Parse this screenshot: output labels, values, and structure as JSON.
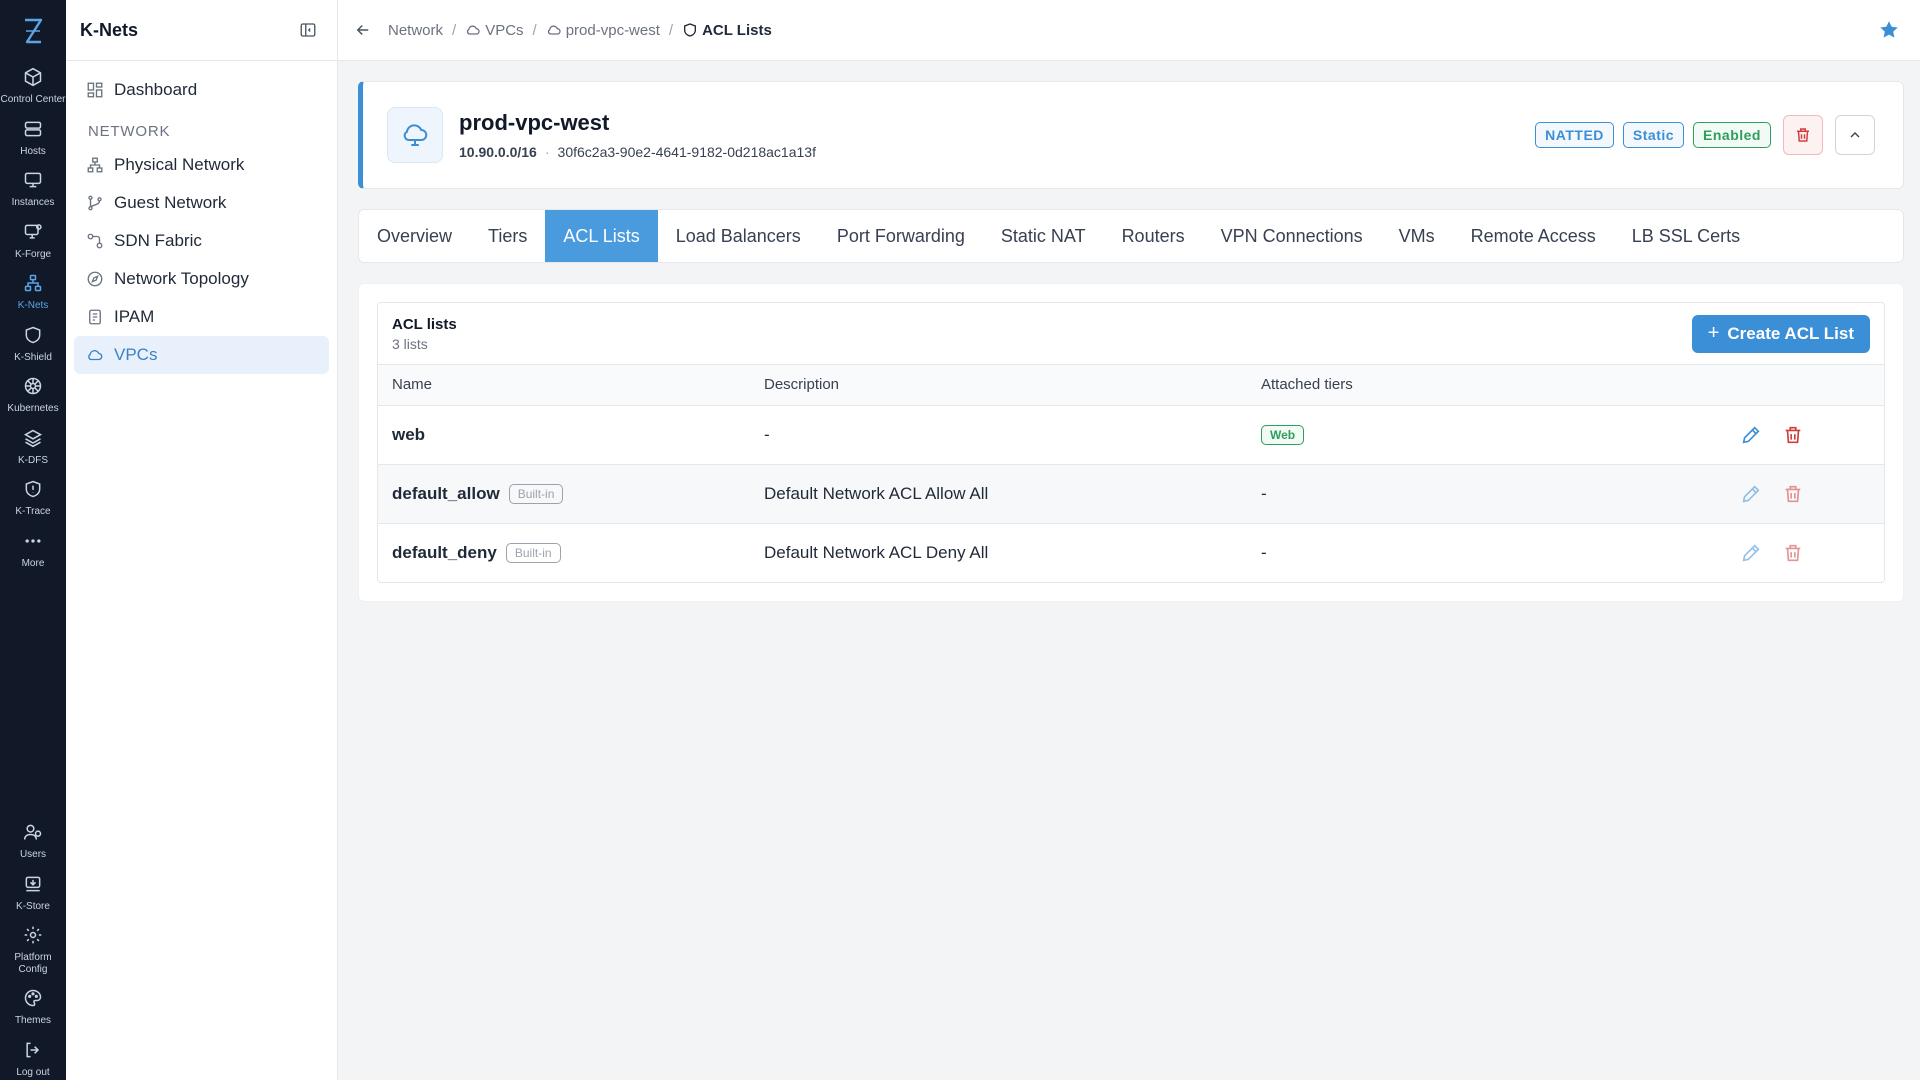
{
  "rail": {
    "items": [
      {
        "label": "Control Center",
        "icon": "cube-icon"
      },
      {
        "label": "Hosts",
        "icon": "server-icon"
      },
      {
        "label": "Instances",
        "icon": "monitor-icon"
      },
      {
        "label": "K-Forge",
        "icon": "forge-icon"
      },
      {
        "label": "K-Nets",
        "icon": "network-icon",
        "active": true
      },
      {
        "label": "K-Shield",
        "icon": "shield-icon"
      },
      {
        "label": "Kubernetes",
        "icon": "helm-icon"
      },
      {
        "label": "K-DFS",
        "icon": "layers-icon"
      },
      {
        "label": "K-Trace",
        "icon": "trace-shield-icon"
      },
      {
        "label": "More",
        "icon": "ellipsis-icon"
      }
    ],
    "bottom": [
      {
        "label": "Users",
        "icon": "users-icon"
      },
      {
        "label": "K-Store",
        "icon": "store-icon"
      },
      {
        "label": "Platform Config",
        "icon": "gear-icon"
      },
      {
        "label": "Themes",
        "icon": "palette-icon"
      },
      {
        "label": "Log out",
        "icon": "logout-icon"
      }
    ]
  },
  "sidebar": {
    "title": "K-Nets",
    "dashboard": "Dashboard",
    "section": "NETWORK",
    "items": [
      {
        "label": "Physical Network"
      },
      {
        "label": "Guest Network"
      },
      {
        "label": "SDN Fabric"
      },
      {
        "label": "Network Topology"
      },
      {
        "label": "IPAM"
      },
      {
        "label": "VPCs",
        "active": true
      }
    ]
  },
  "breadcrumb": {
    "items": [
      "Network",
      "VPCs",
      "prod-vpc-west",
      "ACL Lists"
    ]
  },
  "vpc": {
    "name": "prod-vpc-west",
    "cidr": "10.90.0.0/16",
    "id": "30f6c2a3-90e2-4641-9182-0d218ac1a13f",
    "badges": [
      "NATTED",
      "Static",
      "Enabled"
    ]
  },
  "tabs": [
    "Overview",
    "Tiers",
    "ACL Lists",
    "Load Balancers",
    "Port Forwarding",
    "Static NAT",
    "Routers",
    "VPN Connections",
    "VMs",
    "Remote Access",
    "LB SSL Certs"
  ],
  "active_tab": "ACL Lists",
  "acl": {
    "title": "ACL lists",
    "subtitle": "3 lists",
    "create_label": "Create ACL List",
    "columns": [
      "Name",
      "Description",
      "Attached tiers"
    ],
    "builtin_label": "Built-in",
    "rows": [
      {
        "name": "web",
        "description": "-",
        "tiers": "Web",
        "builtin": false
      },
      {
        "name": "default_allow",
        "description": "Default Network ACL Allow All",
        "tiers": "-",
        "builtin": true
      },
      {
        "name": "default_deny",
        "description": "Default Network ACL Deny All",
        "tiers": "-",
        "builtin": true
      }
    ]
  },
  "colors": {
    "accent": "#3b8fd6",
    "rail_bg": "#111827",
    "success": "#2f9e5a",
    "danger": "#d33c3c"
  }
}
